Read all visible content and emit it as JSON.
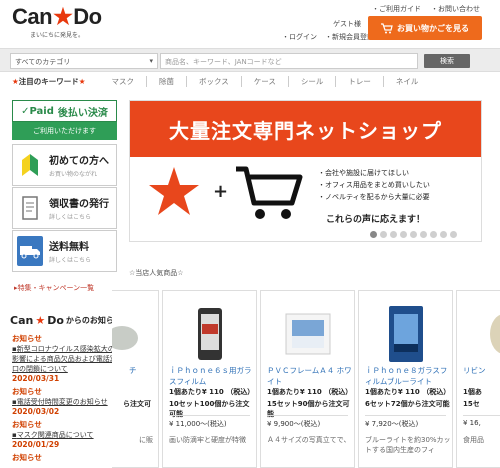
{
  "logo": {
    "brand_left": "Can",
    "brand_right": "Do",
    "tagline": "まいにちに発見を。"
  },
  "header": {
    "top_links": [
      "ご利用ガイド",
      "お問い合わせ"
    ],
    "guest": "ゲスト様",
    "sub_links": [
      "ログイン",
      "新規会員登録"
    ],
    "cart_button": "お買い物かごを見る"
  },
  "search": {
    "category": "すべてのカテゴリ",
    "placeholder": "商品名、キーワード、JANコードなど",
    "button": "検索"
  },
  "keywords": {
    "title": "注目のキーワード",
    "items": [
      "マスク",
      "除菌",
      "ボックス",
      "ケース",
      "シール",
      "トレー",
      "ネイル"
    ]
  },
  "sidebar": {
    "paid_logo": "Paid",
    "paid_title": "後払い決済",
    "paid_sub": "ご利用いただけます",
    "menu": [
      {
        "title": "初めての方へ",
        "sub": "お買い物のながれ"
      },
      {
        "title": "領収書の発行",
        "sub": "詳しくはこちら"
      },
      {
        "title": "送料無料",
        "sub": "詳しくはこちら"
      }
    ],
    "special": "特集・キャンペーン一覧"
  },
  "news": {
    "title_suffix": "からのお知らせ",
    "items": [
      {
        "label": "お知らせ",
        "body": "新型コロナウイルス感染拡大の影響による商品欠品および電話窓口の閉鎖について",
        "date": "2020/03/31"
      },
      {
        "label": "お知らせ",
        "body": "電話受付時間変更のお知らせ",
        "date": "2020/03/02"
      },
      {
        "label": "お知らせ",
        "body": "マスク関連商品について",
        "date": "2020/01/29"
      },
      {
        "label": "お知らせ",
        "body": "",
        "date": ""
      }
    ]
  },
  "banner": {
    "headline": "大量注文専門ネットショップ",
    "bullets": [
      "・会社や施設に届けてほしい",
      "・オフィス用品をまとめ買いしたい",
      "・ノベルティを配るから大量に必要"
    ],
    "call": "これらの声に応えます！",
    "dot_count": 9
  },
  "popular": {
    "header": "☆当店人気商品☆",
    "products": [
      {
        "name": "チ",
        "unit": "",
        "promo": "ら注文可",
        "set": "",
        "desc": "に販"
      },
      {
        "name": "ｉＰｈｏｎｅ６ｓ用ガラスフィルム",
        "unit": "1個あたり¥ 110 （税込）",
        "promo": "10セット100個から注文可能",
        "set": "¥ 11,000～(税込)",
        "desc": "画い防滴牢と硬度が特徴"
      },
      {
        "name": "ＰＶＣフレームＡ４ ホワイト",
        "unit": "1個あたり¥ 110 （税込）",
        "promo": "15セット90個から注文可能",
        "set": "¥ 9,900～(税込)",
        "desc": "Ａ４サイズの写真立てで、"
      },
      {
        "name": "ｉＰｈｏｎｅ８ガラスフィルムブルーライト",
        "unit": "1個あたり¥ 110 （税込）",
        "promo": "6セット72個から注文可能",
        "set": "¥ 7,920～(税込)",
        "desc": "ブルーライトを約30%カットする国内生産のフィ"
      },
      {
        "name": "リビン",
        "unit": "1個あ",
        "promo": "15セ",
        "set": "¥ 16,",
        "desc": "食用品"
      }
    ]
  },
  "colors": {
    "accent": "#e8471c",
    "cart": "#ee6a1c",
    "paid_green": "#2f9e57",
    "news": "#d04000",
    "product_link": "#2d6fb6"
  }
}
